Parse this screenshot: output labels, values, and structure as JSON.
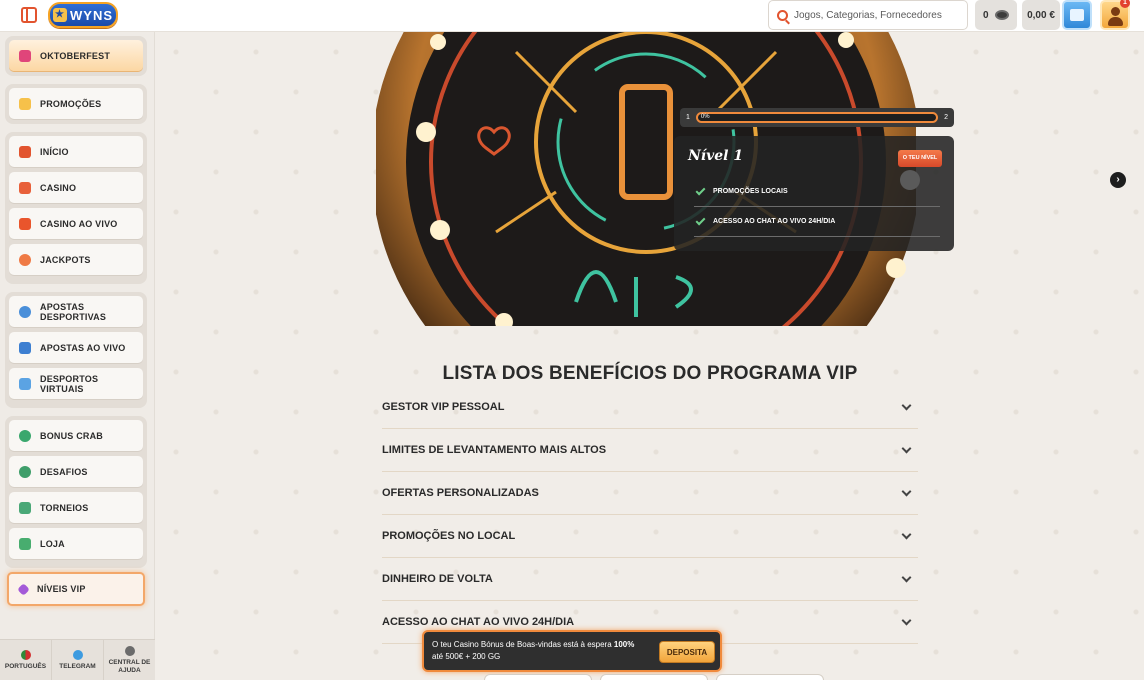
{
  "header": {
    "logo_text": "WYNS",
    "search_placeholder": "Jogos, Categorias, Fornecedores",
    "coins": "0",
    "balance": "0,00 €",
    "notification_count": "1"
  },
  "sidebar": {
    "featured": [
      {
        "label": "OKTOBERFEST",
        "icon": "beer-icon"
      },
      {
        "label": "PROMOÇÕES",
        "icon": "gift-icon"
      }
    ],
    "casino": [
      {
        "label": "INÍCIO",
        "icon": "home-icon"
      },
      {
        "label": "CASINO",
        "icon": "slot-machine-icon"
      },
      {
        "label": "CASINO AO VIVO",
        "icon": "live-casino-icon"
      },
      {
        "label": "JACKPOTS",
        "icon": "clover-icon"
      }
    ],
    "sports": [
      {
        "label": "APOSTAS DESPORTIVAS",
        "icon": "ball-icon"
      },
      {
        "label": "APOSTAS AO VIVO",
        "icon": "live-badge-icon"
      },
      {
        "label": "DESPORTOS VIRTUAIS",
        "icon": "monitor-icon"
      }
    ],
    "extras": [
      {
        "label": "BONUS CRAB",
        "icon": "crab-icon"
      },
      {
        "label": "DESAFIOS",
        "icon": "medal-icon"
      },
      {
        "label": "TORNEIOS",
        "icon": "podium-icon"
      },
      {
        "label": "LOJA",
        "icon": "basket-icon"
      }
    ],
    "vip": {
      "label": "NÍVEIS VIP",
      "icon": "diamond-icon"
    },
    "footer": [
      {
        "label": "PORTUGUÊS",
        "icon": "portugal-flag-icon"
      },
      {
        "label": "TELEGRAM",
        "icon": "telegram-icon"
      },
      {
        "label": "CENTRAL DE AJUDA",
        "icon": "help-icon"
      }
    ]
  },
  "hero": {
    "progress": {
      "from_level": "1",
      "to_level": "2",
      "percent_label": "0%",
      "percent": 0
    },
    "level_card": {
      "title": "Nível 1",
      "badge": "O TEU NÍVEL",
      "perks": [
        "PROMOÇÕES LOCAIS",
        "ACESSO AO CHAT AO VIVO 24H/DIA"
      ]
    },
    "next_icon": "chevron-right-icon"
  },
  "benefits": {
    "title": "LISTA DOS BENEFÍCIOS DO PROGRAMA VIP",
    "items": [
      "GESTOR VIP PESSOAL",
      "LIMITES DE LEVANTAMENTO MAIS ALTOS",
      "OFERTAS PERSONALIZADAS",
      "PROMOÇÕES NO LOCAL",
      "DINHEIRO DE VOLTA",
      "ACESSO AO CHAT AO VIVO 24H/DIA"
    ]
  },
  "promo": {
    "text_prefix": "O teu Casino Bónus de Boas-vindas está à espera ",
    "text_bold": "100%",
    "text_line2": "até 500€ + 200 GG",
    "button": "DEPOSITA"
  },
  "colors": {
    "accent": "#e2542f",
    "highlight": "#f08a3c",
    "background": "#f1ede8"
  }
}
